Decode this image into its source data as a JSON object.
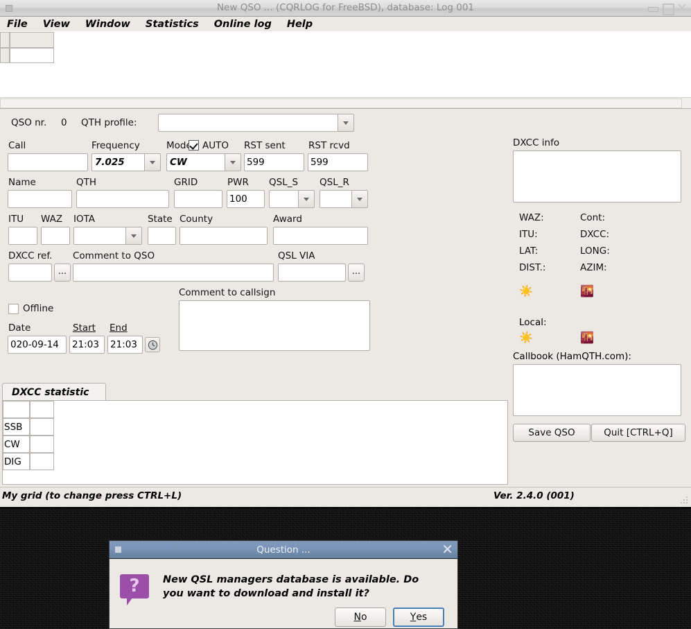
{
  "window": {
    "title": "New QSO ... (CQRLOG for FreeBSD), database: Log 001",
    "minimize_icon": "minimize-icon",
    "maximize_icon": "maximize-icon",
    "close_icon": "close-icon"
  },
  "menubar": {
    "items": [
      {
        "label": "File"
      },
      {
        "label": "View"
      },
      {
        "label": "Window"
      },
      {
        "label": "Statistics"
      },
      {
        "label": "Online log"
      },
      {
        "label": "Help"
      }
    ]
  },
  "qso": {
    "nr_label": "QSO nr.",
    "nr_value": "0",
    "qth_profile_label": "QTH profile:",
    "qth_profile_value": "",
    "call_label": "Call",
    "call_value": "",
    "frequency_label": "Frequency",
    "frequency_value": "7.025",
    "mode_label": "Mode",
    "mode_value": "CW",
    "auto_label": "AUTO",
    "auto_checked": true,
    "rst_sent_label": "RST sent",
    "rst_sent_value": "599",
    "rst_rcvd_label": "RST rcvd",
    "rst_rcvd_value": "599",
    "name_label": "Name",
    "name_value": "",
    "qth_label": "QTH",
    "qth_value": "",
    "grid_label": "GRID",
    "grid_value": "",
    "pwr_label": "PWR",
    "pwr_value": "100",
    "qsl_s_label": "QSL_S",
    "qsl_s_value": "",
    "qsl_r_label": "QSL_R",
    "qsl_r_value": "",
    "itu_label": "ITU",
    "itu_value": "",
    "waz_label": "WAZ",
    "waz_value": "",
    "iota_label": "IOTA",
    "iota_value": "",
    "state_label": "State",
    "state_value": "",
    "county_label": "County",
    "county_value": "",
    "award_label": "Award",
    "award_value": "",
    "dxcc_ref_label": "DXCC ref.",
    "dxcc_ref_value": "",
    "dxcc_ref_btn": "...",
    "comment_qso_label": "Comment to QSO",
    "comment_qso_value": "",
    "qsl_via_label": "QSL VIA",
    "qsl_via_value": "",
    "qsl_via_btn": "...",
    "comment_callsign_label": "Comment to callsign",
    "comment_callsign_value": "",
    "offline_label": "Offline",
    "offline_checked": false,
    "date_label": "Date",
    "date_value": "020-09-14",
    "start_label": "Start",
    "start_value": "21:03",
    "end_label": "End",
    "end_value": "21:03",
    "clock_icon": "clock-icon"
  },
  "dxcc_info": {
    "title": "DXCC info",
    "text": "",
    "fields": [
      {
        "k1": "WAZ:",
        "k2": "Cont:"
      },
      {
        "k1": "ITU:",
        "k2": "DXCC:"
      },
      {
        "k1": "LAT:",
        "k2": "LONG:"
      },
      {
        "k1": "DIST.:",
        "k2": "AZIM:"
      }
    ],
    "sun_icon": "sunrise-icon",
    "sunset_icon": "sunset-icon",
    "sunrise_value": "",
    "sunset_value": "",
    "local_label": "Local:",
    "local_sunrise_value": "",
    "local_sunset_value": "",
    "callbook_label": "Callbook (HamQTH.com):",
    "callbook_text": ""
  },
  "actions": {
    "save_label": "Save QSO",
    "quit_label": "Quit [CTRL+Q]"
  },
  "dxcc_statistic": {
    "tab_label": "DXCC statistic",
    "rows": [
      {
        "mode": "",
        "value": ""
      },
      {
        "mode": "SSB",
        "value": ""
      },
      {
        "mode": "CW",
        "value": ""
      },
      {
        "mode": "DIG",
        "value": ""
      }
    ]
  },
  "statusbar": {
    "left": "My grid (to change press CTRL+L)",
    "right": "Ver. 2.4.0 (001)"
  },
  "dialog": {
    "title": "Question ...",
    "close_icon": "close-icon",
    "icon": "question-icon",
    "icon_glyph": "?",
    "message": "New QSL managers database is available. Do you want to download and install it?",
    "no_label": "No",
    "yes_label": "Yes"
  },
  "colors": {
    "window_bg": "#ece9e4",
    "dialog_titlebar": "#7d95b8",
    "question_icon": "#9b4fa8",
    "focus_border": "#4a7fb5"
  }
}
